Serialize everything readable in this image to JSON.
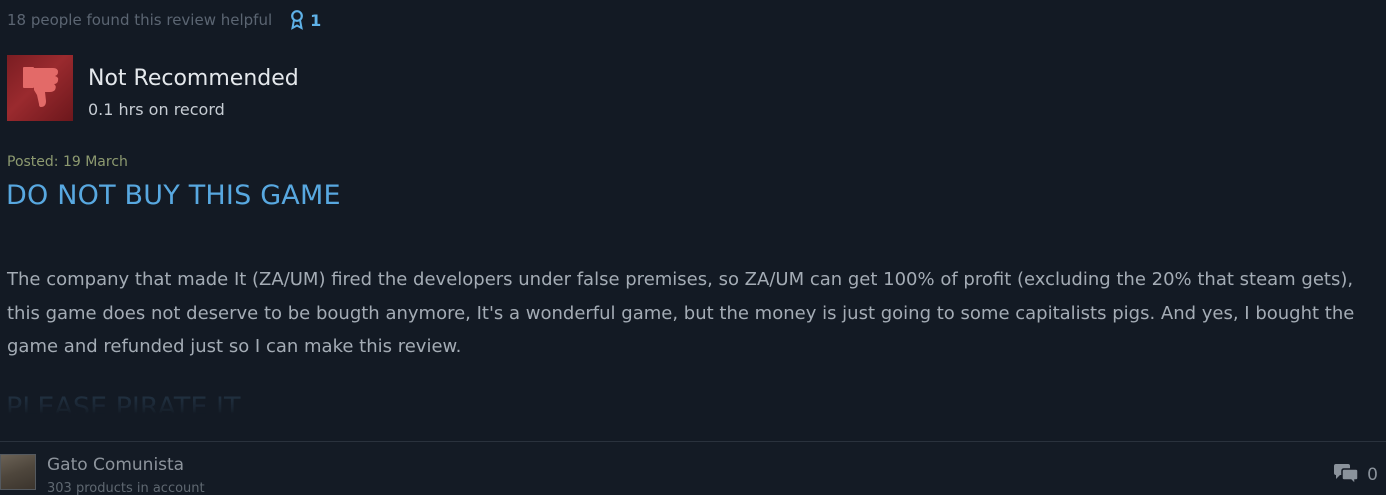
{
  "review": {
    "helpful_text": "18 people found this review helpful",
    "award_count": "1",
    "recommendation": "Not Recommended",
    "hours": "0.1 hrs on record",
    "posted": "Posted: 19 March",
    "headline": "DO NOT BUY THIS GAME",
    "body": "The company that made It (ZA/UM) fired the developers under false premises, so ZA/UM can get 100% of profit (excluding the 20% that steam gets), this game does not deserve to be bougth anymore, It's a wonderful game, but the money is just going to some capitalists pigs. And yes, I bought the game and refunded just so I can make this review.",
    "faded_line": "PLEASE PIRATE IT"
  },
  "author": {
    "name": "Gato Comunista",
    "products": "303 products in account"
  },
  "comments": {
    "count": "0"
  },
  "colors": {
    "background": "#131a24",
    "headline": "#58a8e0",
    "thumb_bg": "#9a2a2e",
    "award": "#5fb2e8"
  },
  "icons": {
    "thumb": "thumbs-down-icon",
    "award": "award-ribbon-icon",
    "comments": "comment-bubbles-icon"
  }
}
